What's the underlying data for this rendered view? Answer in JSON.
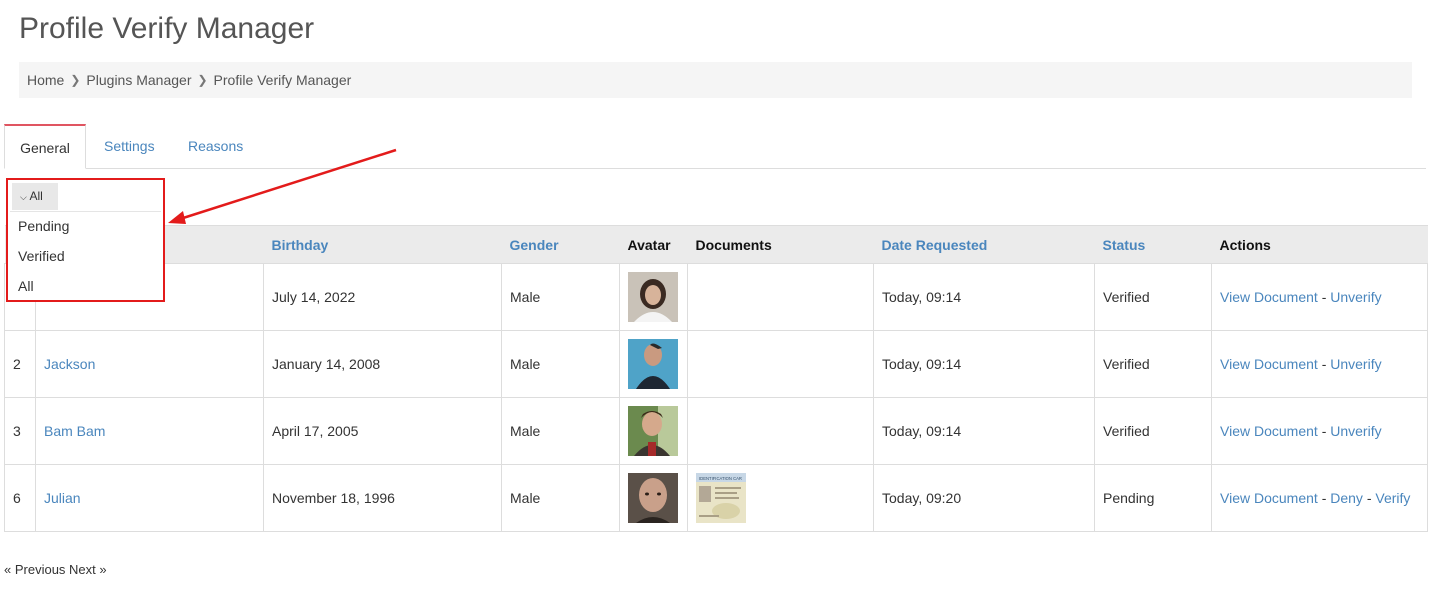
{
  "title": "Profile Verify Manager",
  "breadcrumb": [
    "Home",
    "Plugins Manager",
    "Profile Verify Manager"
  ],
  "tabs": [
    "General",
    "Settings",
    "Reasons"
  ],
  "filter": {
    "selected": "All",
    "options": [
      "Pending",
      "Verified",
      "All"
    ]
  },
  "table": {
    "headers": [
      "Birthday",
      "Gender",
      "Avatar",
      "Documents",
      "Date Requested",
      "Status",
      "Actions"
    ],
    "rows": [
      {
        "id": "",
        "name": "",
        "birthday": "July 14, 2022",
        "gender": "Male",
        "date": "Today, 09:14",
        "status": "Verified",
        "view": "View Document",
        "a1": "Unverify",
        "a2": ""
      },
      {
        "id": "2",
        "name": "Jackson",
        "birthday": "January 14, 2008",
        "gender": "Male",
        "date": "Today, 09:14",
        "status": "Verified",
        "view": "View Document",
        "a1": "Unverify",
        "a2": ""
      },
      {
        "id": "3",
        "name": "Bam Bam",
        "birthday": "April 17, 2005",
        "gender": "Male",
        "date": "Today, 09:14",
        "status": "Verified",
        "view": "View Document",
        "a1": "Unverify",
        "a2": ""
      },
      {
        "id": "6",
        "name": "Julian",
        "birthday": "November 18, 1996",
        "gender": "Male",
        "date": "Today, 09:20",
        "status": "Pending",
        "view": "View Document",
        "a1": "Deny",
        "a2": "Verify"
      }
    ],
    "doc_caption": "IDENTIFICATION CAR"
  },
  "pager": {
    "prev": "« Previous",
    "next": "Next »"
  },
  "colors": {
    "accent": "#4a86bd",
    "highlight": "#e31b1b",
    "active_tab": "#e05561"
  }
}
